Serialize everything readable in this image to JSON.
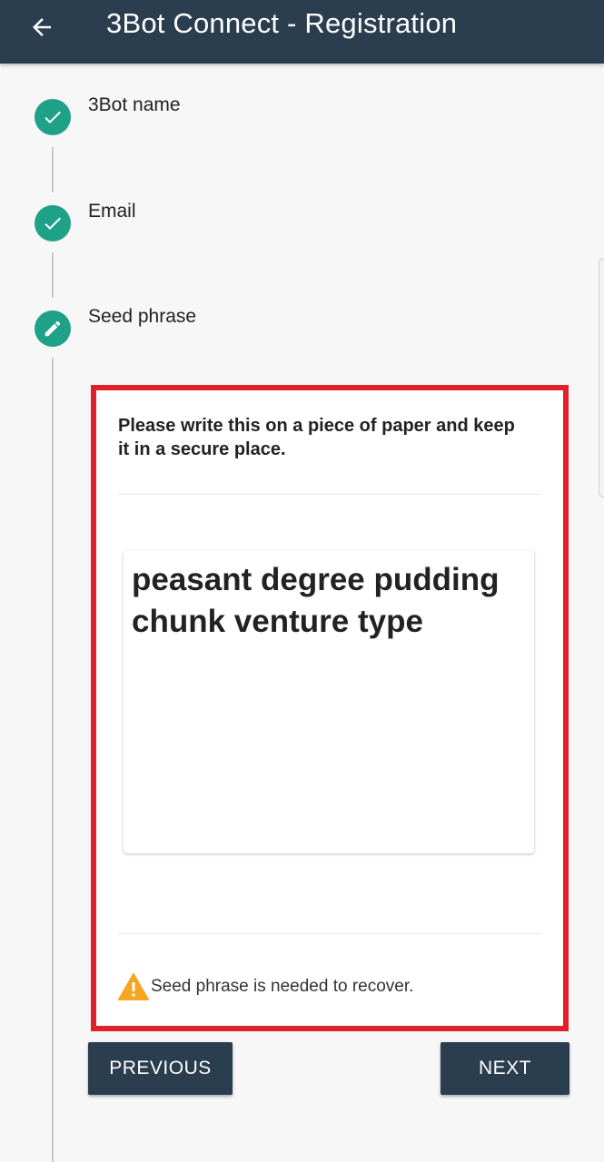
{
  "app_bar": {
    "back_icon": "arrow-left-icon",
    "title": "3Bot Connect - Registration",
    "background": "#2b3e4f"
  },
  "steps": [
    {
      "label": "3Bot name",
      "status": "completed",
      "icon": "check-icon"
    },
    {
      "label": "Email",
      "status": "completed",
      "icon": "check-icon"
    },
    {
      "label": "Seed phrase",
      "status": "active",
      "icon": "pencil-icon"
    }
  ],
  "seed_card": {
    "instruction": "Please write this on a piece of paper and keep it in a secure place.",
    "phrase": "peasant degree pudding chunk venture type",
    "warning_icon": "warning-icon",
    "warning_text": "Seed phrase is needed to recover.",
    "highlight_color": "#e0202a"
  },
  "buttons": {
    "previous_label": "PREVIOUS",
    "next_label": "NEXT"
  },
  "colors": {
    "accent": "#1fa187",
    "warning": "#f5a623"
  }
}
